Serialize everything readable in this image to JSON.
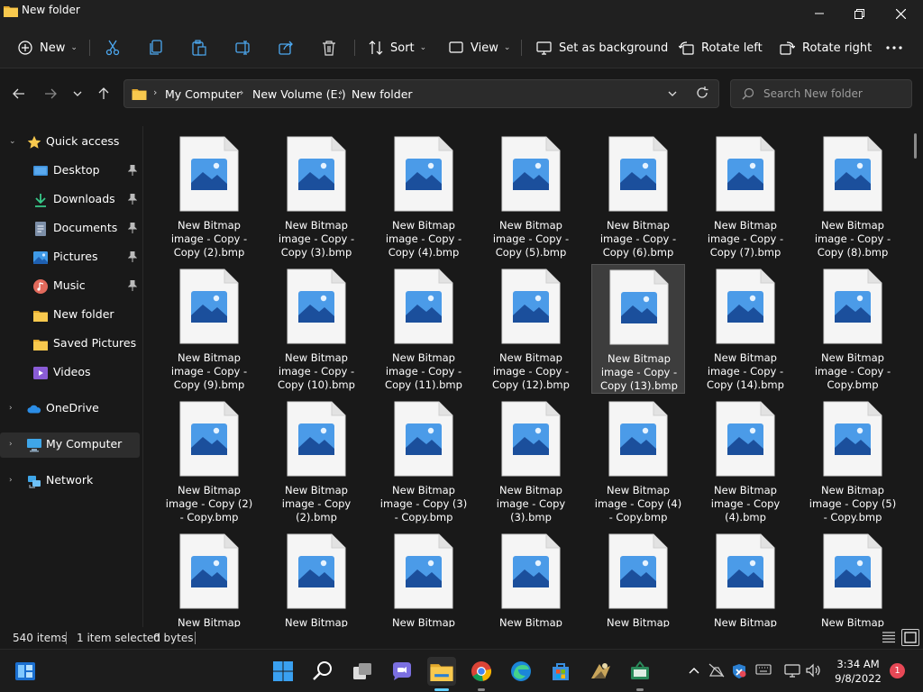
{
  "window": {
    "title": "New folder"
  },
  "toolbar": {
    "new_label": "New",
    "sort_label": "Sort",
    "view_label": "View",
    "set_background_label": "Set as background",
    "rotate_left_label": "Rotate left",
    "rotate_right_label": "Rotate right"
  },
  "address": {
    "crumbs": [
      "My Computer",
      "New Volume (E:)",
      "New folder"
    ]
  },
  "search": {
    "placeholder": "Search New folder"
  },
  "sidebar": {
    "items": [
      {
        "label": "Quick access",
        "icon": "star-icon"
      },
      {
        "label": "Desktop",
        "icon": "desktop-icon",
        "pinned": true
      },
      {
        "label": "Downloads",
        "icon": "download-icon",
        "pinned": true
      },
      {
        "label": "Documents",
        "icon": "document-icon",
        "pinned": true
      },
      {
        "label": "Pictures",
        "icon": "pictures-icon",
        "pinned": true
      },
      {
        "label": "Music",
        "icon": "music-icon",
        "pinned": true
      },
      {
        "label": "New folder",
        "icon": "folder-icon"
      },
      {
        "label": "Saved Pictures",
        "icon": "folder-icon"
      },
      {
        "label": "Videos",
        "icon": "videos-icon"
      },
      {
        "label": "OneDrive",
        "icon": "cloud-icon"
      },
      {
        "label": "My Computer",
        "icon": "computer-icon",
        "selected": true
      },
      {
        "label": "Network",
        "icon": "network-icon"
      }
    ]
  },
  "files": [
    {
      "line1": "New Bitmap",
      "line2": "image - Copy -",
      "line3": "Copy (2).bmp"
    },
    {
      "line1": "New Bitmap",
      "line2": "image - Copy -",
      "line3": "Copy (3).bmp"
    },
    {
      "line1": "New Bitmap",
      "line2": "image - Copy -",
      "line3": "Copy (4).bmp"
    },
    {
      "line1": "New Bitmap",
      "line2": "image - Copy -",
      "line3": "Copy (5).bmp"
    },
    {
      "line1": "New Bitmap",
      "line2": "image - Copy -",
      "line3": "Copy (6).bmp"
    },
    {
      "line1": "New Bitmap",
      "line2": "image - Copy -",
      "line3": "Copy (7).bmp"
    },
    {
      "line1": "New Bitmap",
      "line2": "image - Copy -",
      "line3": "Copy (8).bmp"
    },
    {
      "line1": "New Bitmap",
      "line2": "image - Copy -",
      "line3": "Copy (9).bmp"
    },
    {
      "line1": "New Bitmap",
      "line2": "image - Copy -",
      "line3": "Copy (10).bmp"
    },
    {
      "line1": "New Bitmap",
      "line2": "image - Copy -",
      "line3": "Copy (11).bmp"
    },
    {
      "line1": "New Bitmap",
      "line2": "image - Copy -",
      "line3": "Copy (12).bmp"
    },
    {
      "line1": "New Bitmap",
      "line2": "image - Copy -",
      "line3": "Copy (13).bmp",
      "selected": true
    },
    {
      "line1": "New Bitmap",
      "line2": "image - Copy -",
      "line3": "Copy (14).bmp"
    },
    {
      "line1": "New Bitmap",
      "line2": "image - Copy -",
      "line3": "Copy.bmp"
    },
    {
      "line1": "New Bitmap",
      "line2": "image - Copy (2)",
      "line3": "- Copy.bmp"
    },
    {
      "line1": "New Bitmap",
      "line2": "image - Copy",
      "line3": "(2).bmp"
    },
    {
      "line1": "New Bitmap",
      "line2": "image - Copy (3)",
      "line3": "- Copy.bmp"
    },
    {
      "line1": "New Bitmap",
      "line2": "image - Copy",
      "line3": "(3).bmp"
    },
    {
      "line1": "New Bitmap",
      "line2": "image - Copy (4)",
      "line3": "- Copy.bmp"
    },
    {
      "line1": "New Bitmap",
      "line2": "image - Copy",
      "line3": "(4).bmp"
    },
    {
      "line1": "New Bitmap",
      "line2": "image - Copy (5)",
      "line3": "- Copy.bmp"
    },
    {
      "line1": "New Bitmap",
      "line2": "",
      "line3": ""
    },
    {
      "line1": "New Bitmap",
      "line2": "",
      "line3": ""
    },
    {
      "line1": "New Bitmap",
      "line2": "",
      "line3": ""
    },
    {
      "line1": "New Bitmap",
      "line2": "",
      "line3": ""
    },
    {
      "line1": "New Bitmap",
      "line2": "",
      "line3": ""
    },
    {
      "line1": "New Bitmap",
      "line2": "",
      "line3": ""
    },
    {
      "line1": "New Bitmap",
      "line2": "",
      "line3": ""
    }
  ],
  "status": {
    "item_count": "540 items",
    "selection": "1 item selected",
    "size": "0 bytes"
  },
  "taskbar": {
    "apps": [
      "start-icon",
      "search-icon",
      "task-view-icon",
      "chat-icon",
      "file-explorer-icon",
      "chrome-icon",
      "edge-icon",
      "store-icon",
      "app-icon",
      "app-icon"
    ],
    "time": "3:34 AM",
    "date": "9/8/2022",
    "notification_count": "1"
  },
  "colors": {
    "accent": "#60cdff",
    "folder": "#f4c04a",
    "selection_bg": "#3d3d3d"
  }
}
